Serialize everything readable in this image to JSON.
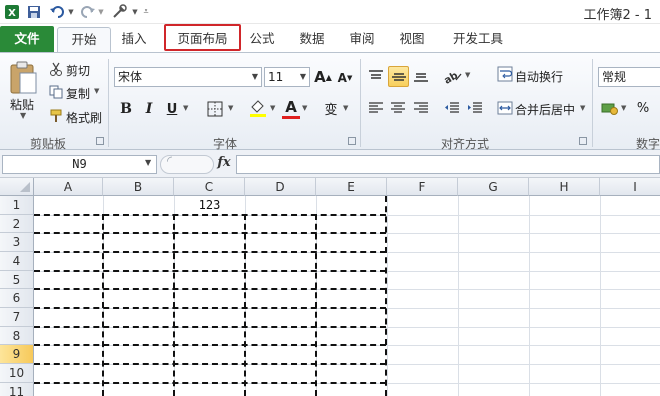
{
  "window": {
    "title": "工作簿2 - 1"
  },
  "tabs": [
    {
      "id": "file",
      "label": "文件"
    },
    {
      "id": "home",
      "label": "开始"
    },
    {
      "id": "insert",
      "label": "插入"
    },
    {
      "id": "pagelayout",
      "label": "页面布局"
    },
    {
      "id": "formulas",
      "label": "公式"
    },
    {
      "id": "data",
      "label": "数据"
    },
    {
      "id": "review",
      "label": "审阅"
    },
    {
      "id": "view",
      "label": "视图"
    },
    {
      "id": "developer",
      "label": "开发工具"
    }
  ],
  "clipboard": {
    "paste": "粘贴",
    "cut": "剪切",
    "copy": "复制",
    "format_painter": "格式刷",
    "group_label": "剪贴板"
  },
  "font": {
    "name": "宋体",
    "size": "11",
    "bold": "B",
    "italic": "I",
    "underline": "U",
    "grow": "A",
    "shrink": "A",
    "font_color_glyph": "A",
    "wen_glyph": "变",
    "group_label": "字体"
  },
  "alignment": {
    "wrap_text": "自动换行",
    "merge_center": "合并后居中",
    "group_label": "对齐方式"
  },
  "number": {
    "format": "常规",
    "percent": "%",
    "group_label": "数字"
  },
  "formula_bar": {
    "name_box": "N9",
    "fx": "fx",
    "value": ""
  },
  "sheet": {
    "columns": [
      "A",
      "B",
      "C",
      "D",
      "E",
      "F",
      "G",
      "H",
      "I"
    ],
    "rows": [
      "1",
      "2",
      "3",
      "4",
      "5",
      "6",
      "7",
      "8",
      "9",
      "10",
      "11"
    ],
    "selected_row": "9",
    "cells": {
      "C1": "123"
    }
  },
  "colors": {
    "file_tab": "#2a8a38",
    "highlight_box": "#d0262a",
    "selected_header": "#f7c95a"
  }
}
